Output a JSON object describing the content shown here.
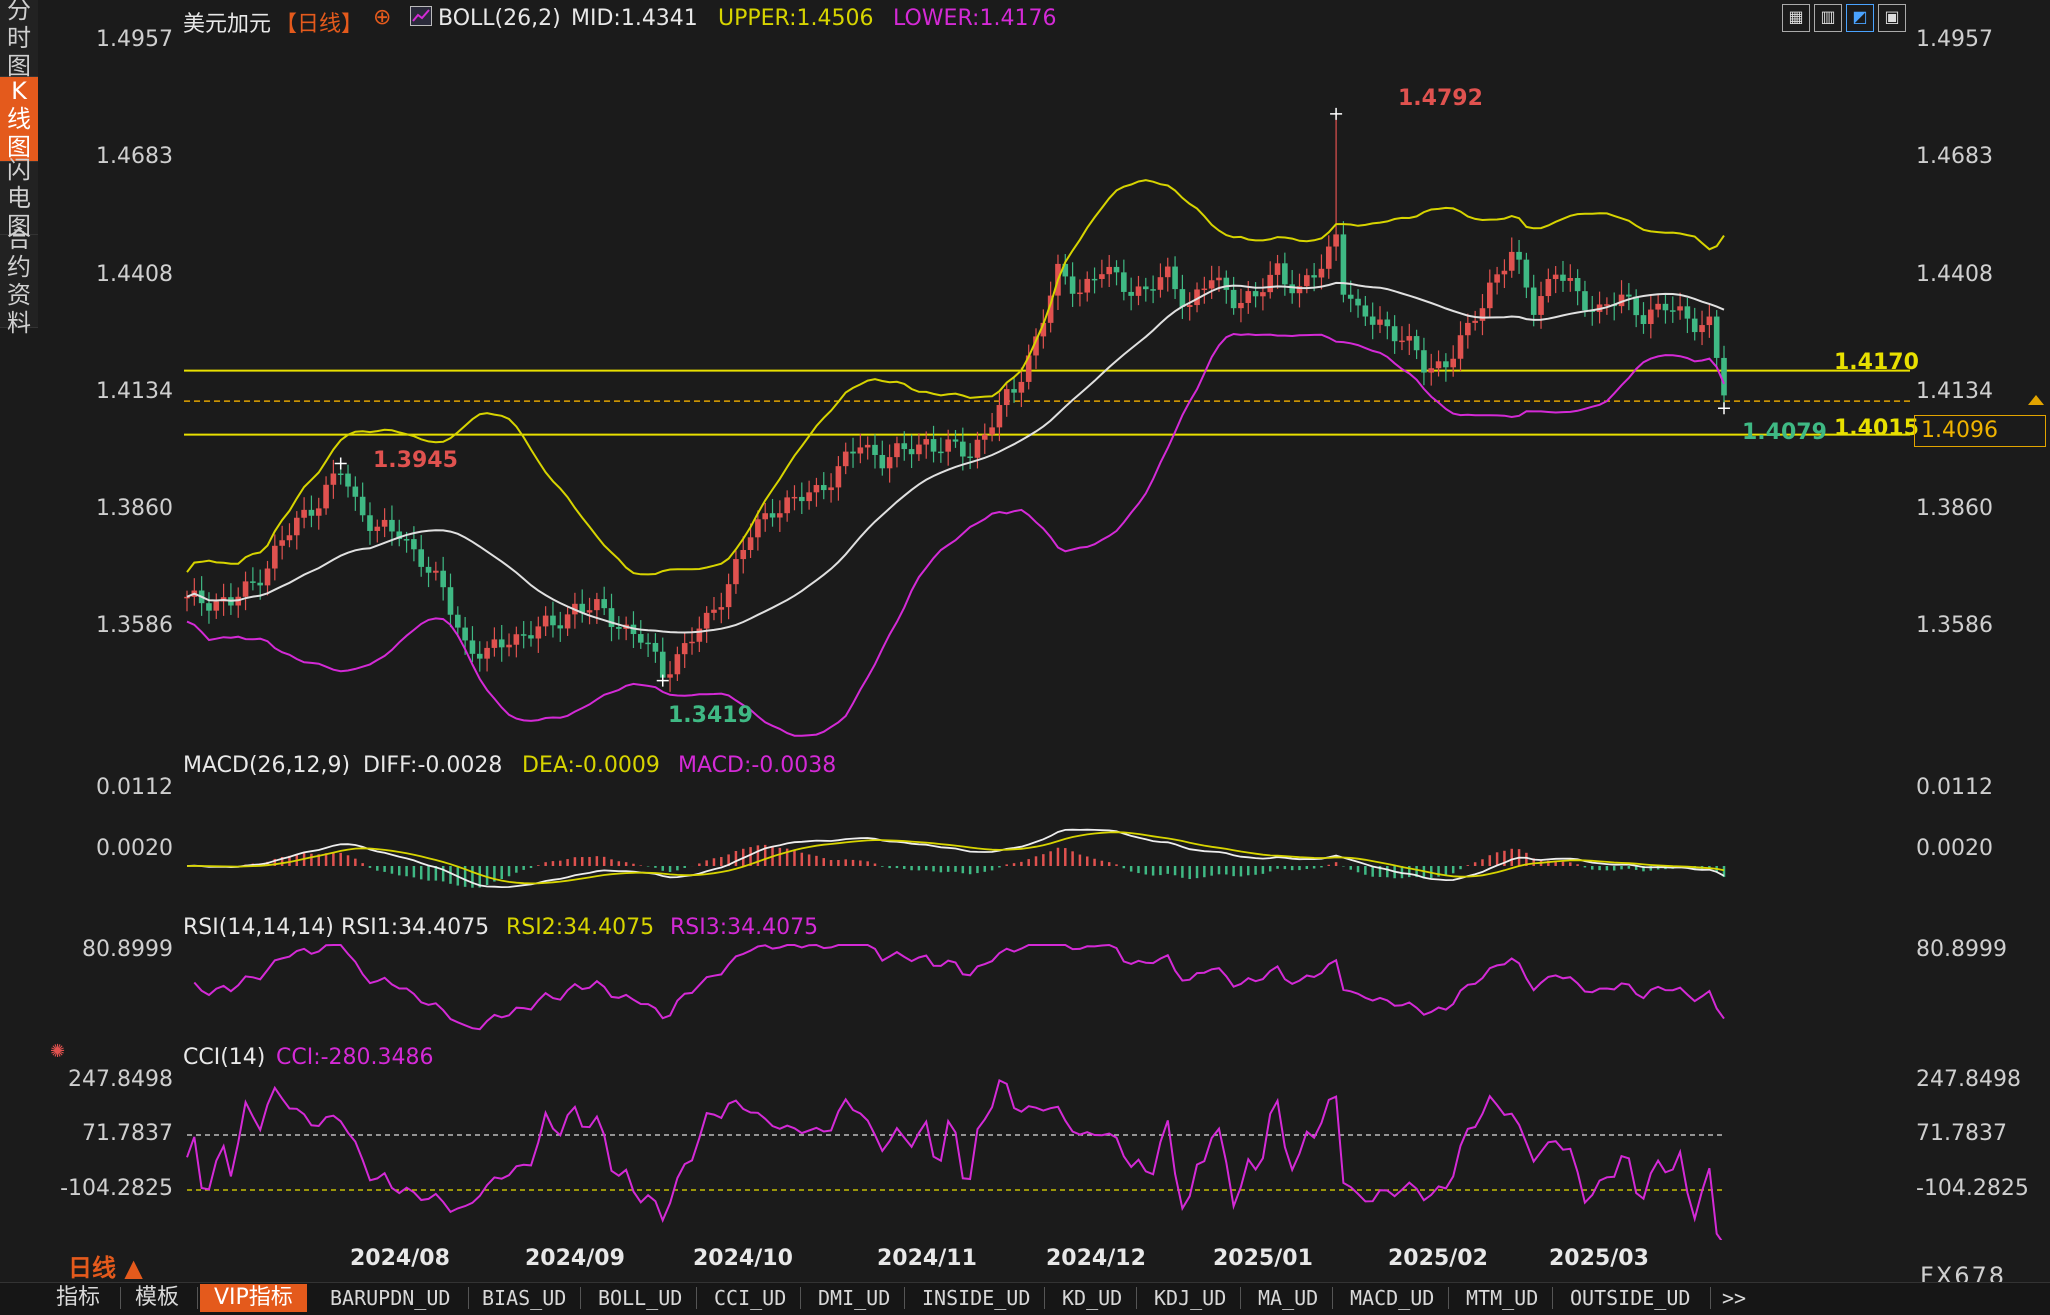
{
  "left_tabs": [
    {
      "label": "分时图"
    },
    {
      "label": "K线图",
      "active": true
    },
    {
      "label": "闪电图"
    },
    {
      "label": "合约资料"
    }
  ],
  "header": {
    "symbol": "美元加元",
    "period": "【日线】",
    "add_icon": "⊕",
    "boll": "BOLL(26,2)",
    "mid": "MID:1.4341",
    "upper": "UPPER:1.4506",
    "lower": "LOWER:1.4176"
  },
  "toolbar": [
    "grid-icon",
    "table-icon",
    "chart-icon",
    "window-icon"
  ],
  "price_axis": [
    "1.4957",
    "1.4683",
    "1.4408",
    "1.4134",
    "1.3860",
    "1.3586"
  ],
  "markers": {
    "high": "1.4792",
    "swing_high": "1.3945",
    "swing_low": "1.3419",
    "last_low": "1.4079"
  },
  "hlines": {
    "upper": "1.4170",
    "lower": "1.4015",
    "current": "1.4096"
  },
  "macd": {
    "title": "MACD(26,12,9)",
    "diff": "DIFF:-0.0028",
    "dea": "DEA:-0.0009",
    "macd": "MACD:-0.0038",
    "axis": [
      "0.0112",
      "0.0020"
    ]
  },
  "rsi": {
    "title": "RSI(14,14,14)",
    "rsi1": "RSI1:34.4075",
    "rsi2": "RSI2:34.4075",
    "rsi3": "RSI3:34.4075",
    "axis": [
      "80.8999"
    ]
  },
  "cci": {
    "title": "CCI(14)",
    "cci": "CCI:-280.3486",
    "axis": [
      "247.8498",
      "71.7837",
      "-104.2825"
    ]
  },
  "x_labels": [
    "2024/08",
    "2024/09",
    "2024/10",
    "2024/11",
    "2024/12",
    "2025/01",
    "2025/02",
    "2025/03"
  ],
  "period_label": "日线 ▲",
  "brand": "FX678",
  "tabs": {
    "main": [
      "指标",
      "模板"
    ],
    "vip": "VIP指标",
    "items": [
      "BARUPDN_UD",
      "BIAS_UD",
      "BOLL_UD",
      "CCI_UD",
      "DMI_UD",
      "INSIDE_UD",
      "KD_UD",
      "KDJ_UD",
      "MA_UD",
      "MACD_UD",
      "MTM_UD",
      "OUTSIDE_UD"
    ],
    "more": ">>"
  },
  "colors": {
    "up": "#e0524f",
    "down": "#3fb984",
    "boll_upper": "#d7d400",
    "boll_mid": "#e0e0e0",
    "boll_lower": "#d42ad6",
    "hline": "#e8e000"
  },
  "chart_data": {
    "type": "candlestick",
    "title": "美元加元【日线】",
    "y_range": [
      1.336,
      1.5
    ],
    "close_path": [
      [
        0,
        1.361
      ],
      [
        3,
        1.3616
      ],
      [
        6,
        1.3606
      ],
      [
        9,
        1.3652
      ],
      [
        12,
        1.373
      ],
      [
        15,
        1.38
      ],
      [
        18,
        1.386
      ],
      [
        21,
        1.3925
      ],
      [
        23,
        1.385
      ],
      [
        26,
        1.379
      ],
      [
        29,
        1.377
      ],
      [
        32,
        1.372
      ],
      [
        35,
        1.363
      ],
      [
        38,
        1.351
      ],
      [
        41,
        1.348
      ],
      [
        44,
        1.352
      ],
      [
        47,
        1.354
      ],
      [
        50,
        1.355
      ],
      [
        53,
        1.36
      ],
      [
        56,
        1.359
      ],
      [
        59,
        1.356
      ],
      [
        62,
        1.352
      ],
      [
        65,
        1.344
      ],
      [
        68,
        1.35
      ],
      [
        71,
        1.356
      ],
      [
        74,
        1.366
      ],
      [
        77,
        1.377
      ],
      [
        80,
        1.384
      ],
      [
        83,
        1.385
      ],
      [
        86,
        1.388
      ],
      [
        89,
        1.393
      ],
      [
        92,
        1.399
      ],
      [
        95,
        1.396
      ],
      [
        98,
        1.397
      ],
      [
        101,
        1.4
      ],
      [
        104,
        1.398
      ],
      [
        107,
        1.397
      ],
      [
        110,
        1.405
      ],
      [
        113,
        1.412
      ],
      [
        116,
        1.425
      ],
      [
        119,
        1.44
      ],
      [
        122,
        1.437
      ],
      [
        125,
        1.441
      ],
      [
        128,
        1.438
      ],
      [
        131,
        1.436
      ],
      [
        134,
        1.44
      ],
      [
        137,
        1.433
      ],
      [
        140,
        1.439
      ],
      [
        143,
        1.435
      ],
      [
        146,
        1.434
      ],
      [
        149,
        1.442
      ],
      [
        152,
        1.436
      ],
      [
        155,
        1.442
      ],
      [
        157,
        1.45
      ],
      [
        158,
        1.438
      ],
      [
        160,
        1.43
      ],
      [
        163,
        1.429
      ],
      [
        166,
        1.425
      ],
      [
        169,
        1.418
      ],
      [
        172,
        1.419
      ],
      [
        175,
        1.426
      ],
      [
        178,
        1.438
      ],
      [
        181,
        1.445
      ],
      [
        184,
        1.433
      ],
      [
        187,
        1.441
      ],
      [
        190,
        1.435
      ],
      [
        193,
        1.432
      ],
      [
        196,
        1.434
      ],
      [
        199,
        1.431
      ],
      [
        202,
        1.432
      ],
      [
        205,
        1.43
      ],
      [
        208,
        1.428
      ],
      [
        210,
        1.411
      ]
    ],
    "n_bars": 211,
    "bollinger": {
      "mid": "MID:1.4341",
      "upper": "UPPER:1.4506",
      "lower": "LOWER:1.4176"
    },
    "levels": [
      1.417,
      1.4015,
      1.4096
    ],
    "annotations": [
      {
        "x": 21,
        "y": 1.3945
      },
      {
        "x": 65,
        "y": 1.3419
      },
      {
        "x": 157,
        "y": 1.4792
      },
      {
        "x": 210,
        "y": 1.4079
      }
    ],
    "x_categories": [
      "2024/08",
      "2024/09",
      "2024/10",
      "2024/11",
      "2024/12",
      "2025/01",
      "2025/02",
      "2025/03"
    ],
    "macd": {
      "diff": -0.0028,
      "dea": -0.0009,
      "macd": -0.0038
    },
    "rsi": [
      34.4075,
      34.4075,
      34.4075
    ],
    "cci": -280.3486
  }
}
